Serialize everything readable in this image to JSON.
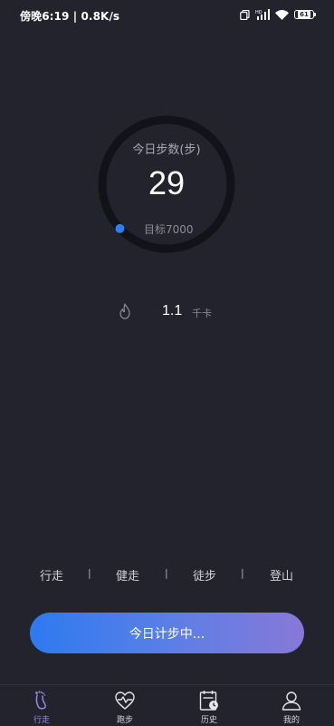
{
  "status_bar": {
    "left_text": "傍晚6:19 | 0.8K/s",
    "battery": "61",
    "icons": [
      "dual-sim-icon",
      "hd-signal-icon",
      "wifi-icon",
      "battery-icon"
    ]
  },
  "today": {
    "title": "今日步数(步)",
    "steps": "29",
    "goal_label": "目标7000",
    "progress_fraction": 0.004
  },
  "calories": {
    "icon": "flame-icon",
    "value": "1.1",
    "unit": "千卡"
  },
  "modes": {
    "items": [
      "行走",
      "健走",
      "徒步",
      "登山"
    ],
    "separator": "|"
  },
  "start_button": {
    "label": "今日计步中..."
  },
  "bottom_nav": {
    "items": [
      {
        "label": "行走",
        "icon": "footprint-icon",
        "active": true
      },
      {
        "label": "跑步",
        "icon": "heart-pulse-icon",
        "active": false
      },
      {
        "label": "历史",
        "icon": "history-calendar-icon",
        "active": false
      },
      {
        "label": "我的",
        "icon": "user-icon",
        "active": false
      }
    ]
  },
  "colors": {
    "background": "#23232e",
    "ring_track": "#121218",
    "accent_blue": "#2f7df6",
    "accent_purple": "#8878d8",
    "nav_active": "#9a86e6"
  }
}
